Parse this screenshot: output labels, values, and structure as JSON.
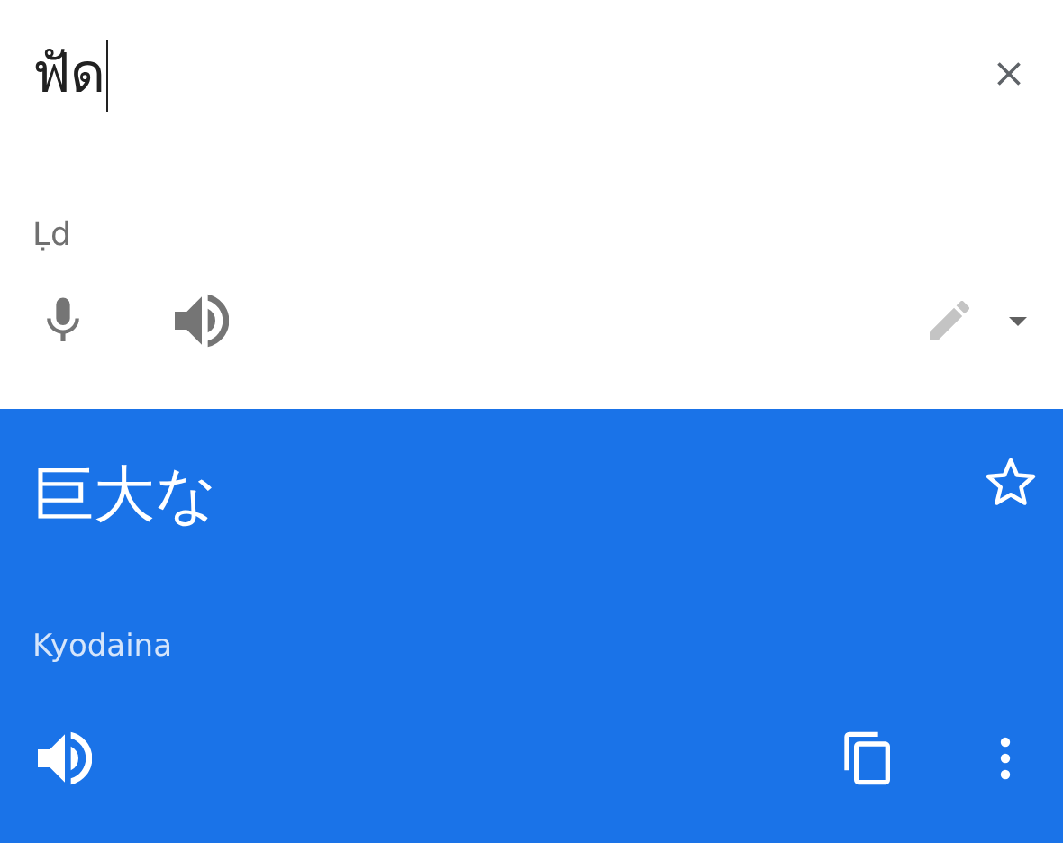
{
  "source": {
    "text": "ฟัด",
    "transliteration": "Ḷd"
  },
  "translation": {
    "text": "巨大な",
    "transliteration": "Kyodaina",
    "starred": false
  }
}
